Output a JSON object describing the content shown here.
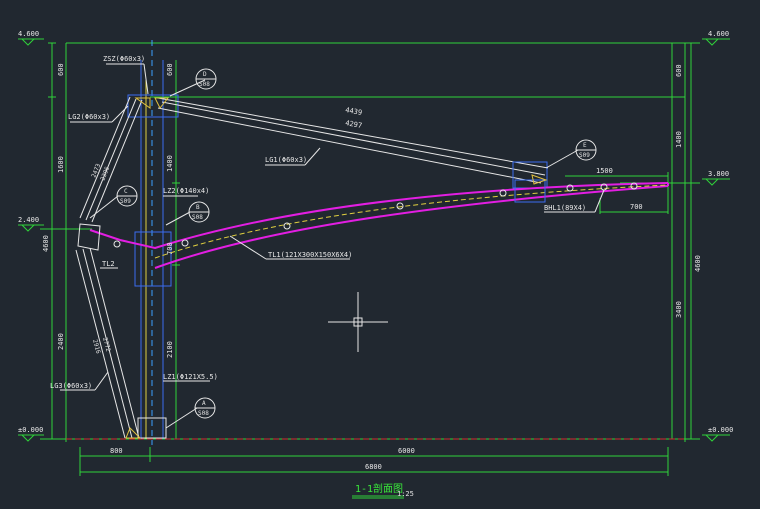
{
  "drawing": {
    "title": "1-1剖面图",
    "scale": "1:25",
    "colors": {
      "background": "#212830",
      "dimension": "#2fd23a",
      "member": "#e6e6e6",
      "tl1": "#e21ee2",
      "column": "#3a6cf0",
      "axis": "#3aa0ff",
      "ground": "#d03030"
    }
  },
  "elevations": {
    "top_left": "4.600",
    "top_right": "4.600",
    "mid_left": "2.400",
    "mid_right": "3.800",
    "base_left": "±0.000",
    "base_right": "±0.000"
  },
  "dimensions": {
    "left_top": "600",
    "left_mid": "1600",
    "left_total": "4600",
    "left_low": "2400",
    "right_top": "600",
    "right_mid": "1400",
    "right_low": "3400",
    "right_total": "4600",
    "col_top": "600",
    "col_mid": "1400",
    "col_low1": "700",
    "col_low2": "2100",
    "bottom_left": "800",
    "bottom_right": "6000",
    "bottom_total": "6800",
    "tl1_tail": "1500",
    "tl1_tail2": "700",
    "lg1_outer": "4439",
    "lg1_inner": "4297",
    "lg2_outer": "2473",
    "lg2_inner": "2396",
    "lg3_outer": "2916",
    "lg3_inner": "2772"
  },
  "members": {
    "zsz": "ZSZ(Φ60x3)",
    "lg2": "LG2(Φ60x3)",
    "lg1": "LG1(Φ60x3)",
    "lz2": "LZ2(Φ140x4)",
    "tl1": "TL1(121X300X150X6X4)",
    "tl2": "TL2",
    "lz1": "LZ1(Φ121X5.5)",
    "lg3": "LG3(Φ60x3)",
    "bhl1": "BHL1(89X4)"
  },
  "details": {
    "d": {
      "letter": "D",
      "ref": "S08"
    },
    "e": {
      "letter": "E",
      "ref": "S09"
    },
    "c": {
      "letter": "C",
      "ref": "S09"
    },
    "b": {
      "letter": "B",
      "ref": "S08"
    },
    "a": {
      "letter": "A",
      "ref": "S08"
    }
  }
}
